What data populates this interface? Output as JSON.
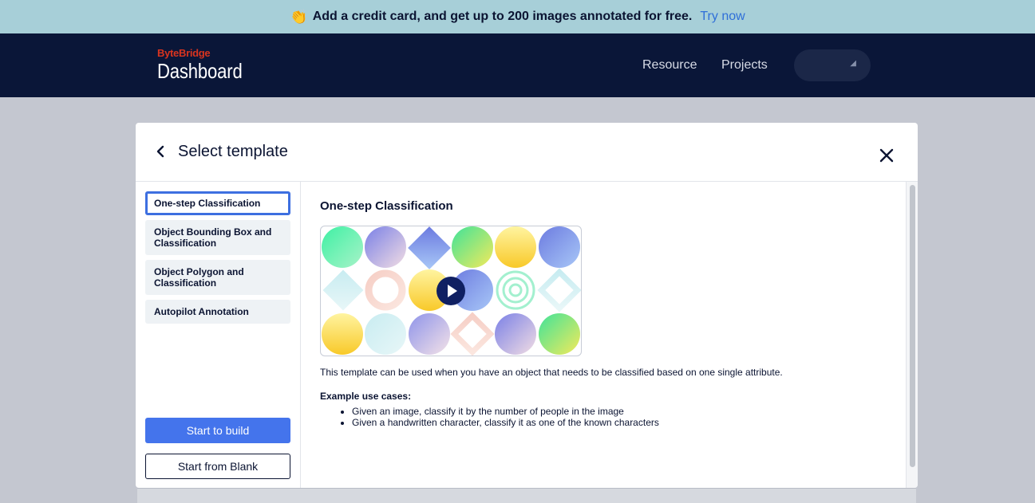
{
  "banner": {
    "emoji": "👏",
    "message": "Add a credit card, and get up to 200 images annotated for free.",
    "cta": "Try now"
  },
  "navbar": {
    "brand": "ByteBridge",
    "product": "Dashboard",
    "links": [
      "Resource",
      "Projects"
    ]
  },
  "modal": {
    "title": "Select template",
    "templates": [
      {
        "label": "One-step Classification",
        "active": true
      },
      {
        "label": "Object Bounding Box and Classification",
        "active": false
      },
      {
        "label": "Object Polygon and Classification",
        "active": false
      },
      {
        "label": "Autopilot Annotation",
        "active": false
      }
    ],
    "build_button": "Start to build",
    "blank_button": "Start from Blank",
    "selected": {
      "title": "One-step Classification",
      "description": "This template can be used when you have an object that needs to be classified based on one single attribute.",
      "use_cases_title": "Example use cases:",
      "use_cases": [
        "Given an image, classify it by the number of people in the image",
        "Given a handwritten character, classify it as one of the known characters"
      ]
    }
  },
  "colors": {
    "banner_bg": "#a7cfd8",
    "navbar_bg": "#0a1638",
    "accent": "#4474ec",
    "brand_red": "#d8341f"
  },
  "icons": [
    "back-icon",
    "close-icon",
    "play-icon",
    "chevron-down-icon"
  ]
}
